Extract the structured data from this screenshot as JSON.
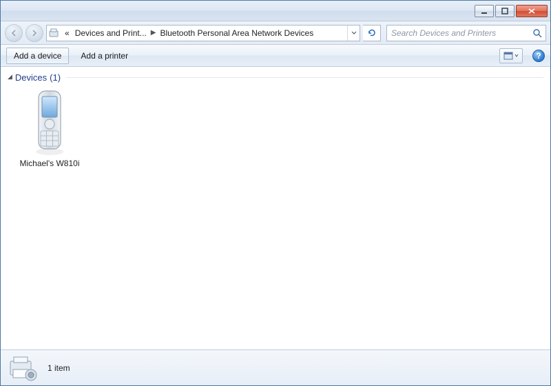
{
  "titlebar": {},
  "nav": {
    "crumb_prefix": "«",
    "crumb1": "Devices and Print...",
    "crumb2": "Bluetooth Personal Area Network Devices"
  },
  "search": {
    "placeholder": "Search Devices and Printers"
  },
  "toolbar": {
    "add_device": "Add a device",
    "add_printer": "Add a printer"
  },
  "group": {
    "name": "Devices",
    "count": "(1)"
  },
  "devices": [
    {
      "label": "Michael's W810i",
      "icon": "phone"
    }
  ],
  "status": {
    "text": "1 item"
  },
  "colors": {
    "link": "#1e3e8a"
  }
}
